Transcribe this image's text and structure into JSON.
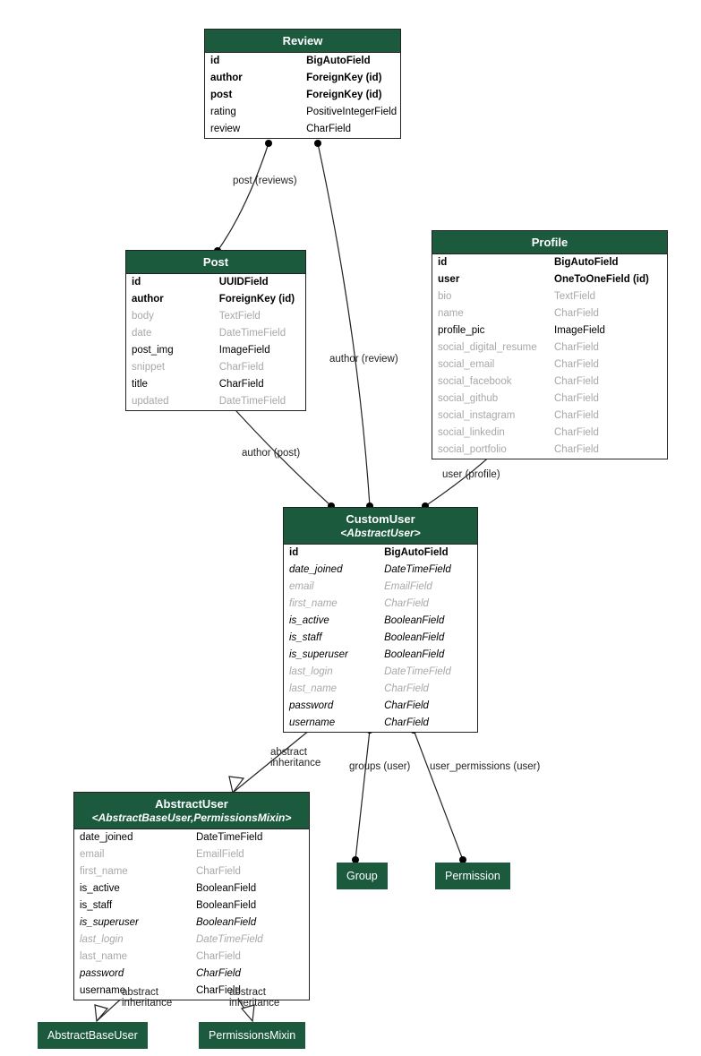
{
  "entities": {
    "review": {
      "title": "Review",
      "fields": [
        {
          "name": "id",
          "type": "BigAutoField",
          "bold": true
        },
        {
          "name": "author",
          "type": "ForeignKey (id)",
          "bold": true
        },
        {
          "name": "post",
          "type": "ForeignKey (id)",
          "bold": true
        },
        {
          "name": "rating",
          "type": "PositiveIntegerField"
        },
        {
          "name": "review",
          "type": "CharField"
        }
      ]
    },
    "post": {
      "title": "Post",
      "fields": [
        {
          "name": "id",
          "type": "UUIDField",
          "bold": true
        },
        {
          "name": "author",
          "type": "ForeignKey (id)",
          "bold": true
        },
        {
          "name": "body",
          "type": "TextField",
          "grey": true
        },
        {
          "name": "date",
          "type": "DateTimeField",
          "grey": true
        },
        {
          "name": "post_img",
          "type": "ImageField"
        },
        {
          "name": "snippet",
          "type": "CharField",
          "grey": true
        },
        {
          "name": "title",
          "type": "CharField"
        },
        {
          "name": "updated",
          "type": "DateTimeField",
          "grey": true
        }
      ]
    },
    "profile": {
      "title": "Profile",
      "fields": [
        {
          "name": "id",
          "type": "BigAutoField",
          "bold": true
        },
        {
          "name": "user",
          "type": "OneToOneField (id)",
          "bold": true
        },
        {
          "name": "bio",
          "type": "TextField",
          "grey": true
        },
        {
          "name": "name",
          "type": "CharField",
          "grey": true
        },
        {
          "name": "profile_pic",
          "type": "ImageField"
        },
        {
          "name": "social_digital_resume",
          "type": "CharField",
          "grey": true
        },
        {
          "name": "social_email",
          "type": "CharField",
          "grey": true
        },
        {
          "name": "social_facebook",
          "type": "CharField",
          "grey": true
        },
        {
          "name": "social_github",
          "type": "CharField",
          "grey": true
        },
        {
          "name": "social_instagram",
          "type": "CharField",
          "grey": true
        },
        {
          "name": "social_linkedin",
          "type": "CharField",
          "grey": true
        },
        {
          "name": "social_portfolio",
          "type": "CharField",
          "grey": true
        }
      ]
    },
    "customuser": {
      "title": "CustomUser",
      "subtitle": "<AbstractUser>",
      "fields": [
        {
          "name": "id",
          "type": "BigAutoField",
          "bold": true
        },
        {
          "name": "date_joined",
          "type": "DateTimeField",
          "ital": true
        },
        {
          "name": "email",
          "type": "EmailField",
          "ital": true,
          "grey": true
        },
        {
          "name": "first_name",
          "type": "CharField",
          "ital": true,
          "grey": true
        },
        {
          "name": "is_active",
          "type": "BooleanField",
          "ital": true
        },
        {
          "name": "is_staff",
          "type": "BooleanField",
          "ital": true
        },
        {
          "name": "is_superuser",
          "type": "BooleanField",
          "ital": true
        },
        {
          "name": "last_login",
          "type": "DateTimeField",
          "ital": true,
          "grey": true
        },
        {
          "name": "last_name",
          "type": "CharField",
          "ital": true,
          "grey": true
        },
        {
          "name": "password",
          "type": "CharField",
          "ital": true
        },
        {
          "name": "username",
          "type": "CharField",
          "ital": true
        }
      ]
    },
    "abstractuser": {
      "title": "AbstractUser",
      "subtitle": "<AbstractBaseUser,PermissionsMixin>",
      "fields": [
        {
          "name": "date_joined",
          "type": "DateTimeField"
        },
        {
          "name": "email",
          "type": "EmailField",
          "grey": true
        },
        {
          "name": "first_name",
          "type": "CharField",
          "grey": true
        },
        {
          "name": "is_active",
          "type": "BooleanField"
        },
        {
          "name": "is_staff",
          "type": "BooleanField"
        },
        {
          "name": "is_superuser",
          "type": "BooleanField",
          "ital": true
        },
        {
          "name": "last_login",
          "type": "DateTimeField",
          "ital": true,
          "grey": true
        },
        {
          "name": "last_name",
          "type": "CharField",
          "grey": true
        },
        {
          "name": "password",
          "type": "CharField",
          "ital": true
        },
        {
          "name": "username",
          "type": "CharField"
        }
      ]
    }
  },
  "boxes": {
    "group": "Group",
    "permission": "Permission",
    "abstractbaseuser": "AbstractBaseUser",
    "permissionsmixin": "PermissionsMixin"
  },
  "labels": {
    "post_reviews": "post (reviews)",
    "author_review": "author (review)",
    "author_post": "author (post)",
    "user_profile": "user (profile)",
    "abstract_inheritance": "abstract\ninheritance",
    "groups_user": "groups (user)",
    "user_permissions_user": "user_permissions (user)"
  }
}
